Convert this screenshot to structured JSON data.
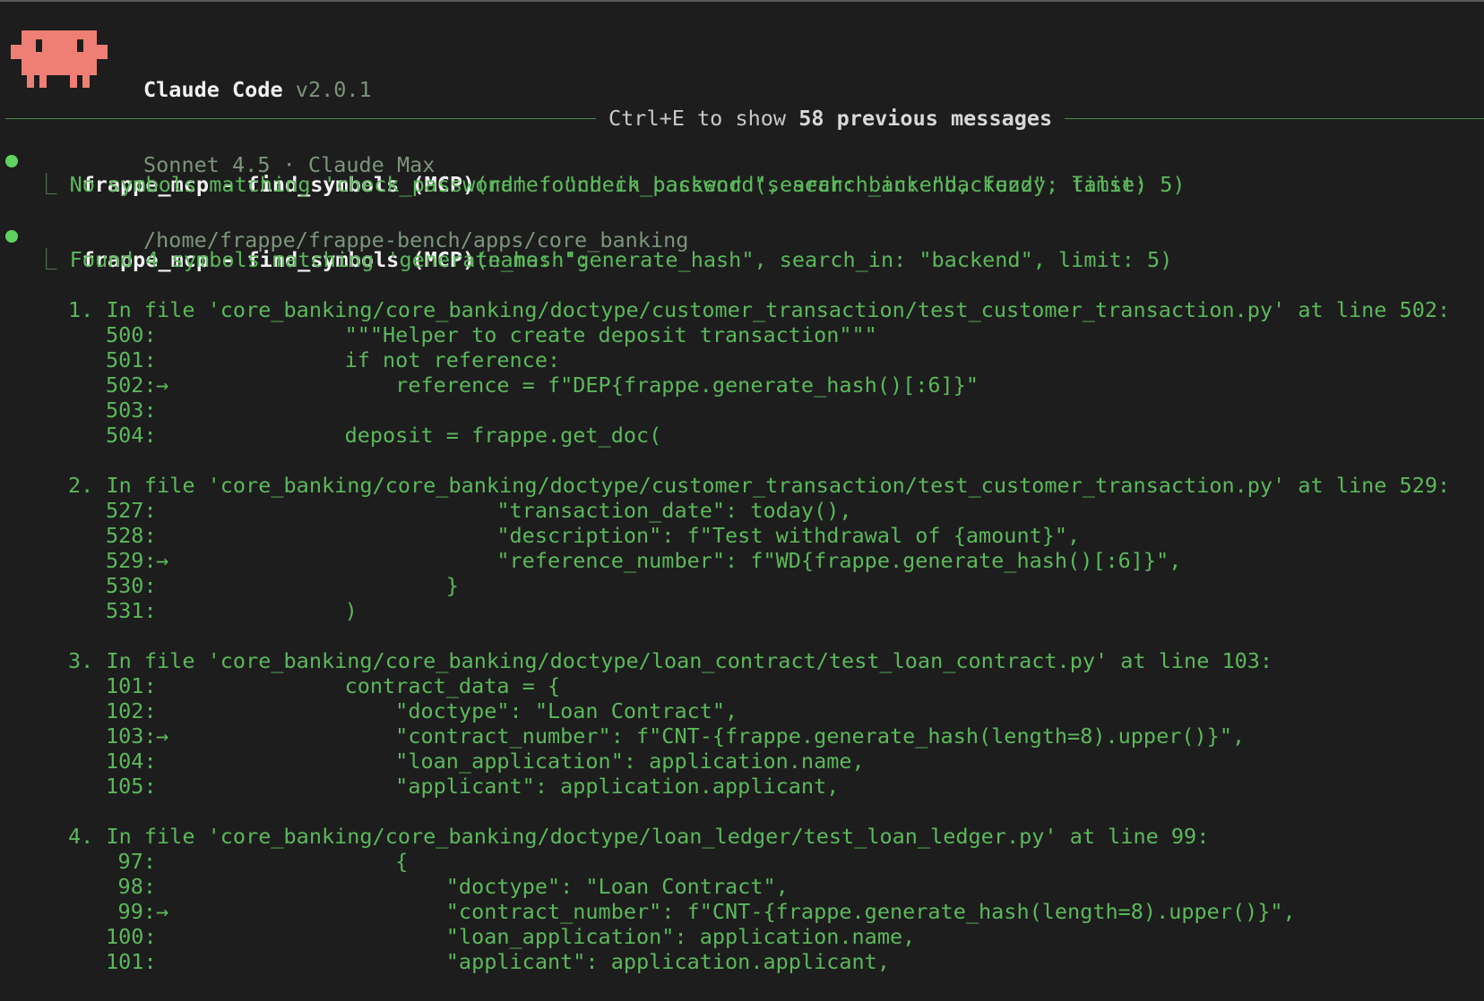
{
  "header": {
    "app_name": "Claude Code",
    "version": "v2.0.1",
    "model": "Sonnet 4.5 · Claude Max",
    "path": "/home/frappe/frappe-bench/apps/core_banking"
  },
  "divider": {
    "prefix": "Ctrl+E to show ",
    "count": "58 previous messages"
  },
  "calls": [
    {
      "tool": "frappe_mcp - find_symbols (MCP)",
      "args": "(name: \"check_password\", search_in: \"backend\", limit: 5)",
      "result": "No symbols matching 'check_password' found in backend (search: backend, fuzzy: false)"
    },
    {
      "tool": "frappe_mcp - find_symbols (MCP)",
      "args": "(name: \"generate_hash\", search_in: \"backend\", limit: 5)",
      "result": "Found 4 symbols matching 'generate_hash':"
    }
  ],
  "matches": [
    {
      "heading": "1. In file 'core_banking/core_banking/doctype/customer_transaction/test_customer_transaction.py' at line 502:",
      "lines": [
        {
          "num": "500:",
          "arrow": "",
          "code": "    \"\"\"Helper to create deposit transaction\"\"\""
        },
        {
          "num": "501:",
          "arrow": "",
          "code": "    if not reference:"
        },
        {
          "num": "502:",
          "arrow": "→",
          "code": "        reference = f\"DEP{frappe.generate_hash()[:6]}\""
        },
        {
          "num": "503:",
          "arrow": "",
          "code": ""
        },
        {
          "num": "504:",
          "arrow": "",
          "code": "    deposit = frappe.get_doc("
        }
      ]
    },
    {
      "heading": "2. In file 'core_banking/core_banking/doctype/customer_transaction/test_customer_transaction.py' at line 529:",
      "lines": [
        {
          "num": "527:",
          "arrow": "",
          "code": "                \"transaction_date\": today(),"
        },
        {
          "num": "528:",
          "arrow": "",
          "code": "                \"description\": f\"Test withdrawal of {amount}\","
        },
        {
          "num": "529:",
          "arrow": "→",
          "code": "                \"reference_number\": f\"WD{frappe.generate_hash()[:6]}\","
        },
        {
          "num": "530:",
          "arrow": "",
          "code": "            }"
        },
        {
          "num": "531:",
          "arrow": "",
          "code": "    )"
        }
      ]
    },
    {
      "heading": "3. In file 'core_banking/core_banking/doctype/loan_contract/test_loan_contract.py' at line 103:",
      "lines": [
        {
          "num": "101:",
          "arrow": "",
          "code": "    contract_data = {"
        },
        {
          "num": "102:",
          "arrow": "",
          "code": "        \"doctype\": \"Loan Contract\","
        },
        {
          "num": "103:",
          "arrow": "→",
          "code": "        \"contract_number\": f\"CNT-{frappe.generate_hash(length=8).upper()}\","
        },
        {
          "num": "104:",
          "arrow": "",
          "code": "        \"loan_application\": application.name,"
        },
        {
          "num": "105:",
          "arrow": "",
          "code": "        \"applicant\": application.applicant,"
        }
      ]
    },
    {
      "heading": "4. In file 'core_banking/core_banking/doctype/loan_ledger/test_loan_ledger.py' at line 99:",
      "lines": [
        {
          "num": "97:",
          "arrow": "",
          "code": "        {"
        },
        {
          "num": "98:",
          "arrow": "",
          "code": "            \"doctype\": \"Loan Contract\","
        },
        {
          "num": "99:",
          "arrow": "→",
          "code": "            \"contract_number\": f\"CNT-{frappe.generate_hash(length=8).upper()}\","
        },
        {
          "num": "100:",
          "arrow": "",
          "code": "            \"loan_application\": application.name,"
        },
        {
          "num": "101:",
          "arrow": "",
          "code": "            \"applicant\": application.applicant,"
        }
      ]
    }
  ],
  "colors": {
    "background": "#1d1d1d",
    "text_green": "#5bb85b",
    "bullet_green": "#5fd35f",
    "logo_salmon": "#ef7f74"
  },
  "icons": {
    "logo": "claude-pixel-mascot-icon",
    "bullet": "status-dot-icon",
    "corner": "tree-corner-glyph"
  }
}
